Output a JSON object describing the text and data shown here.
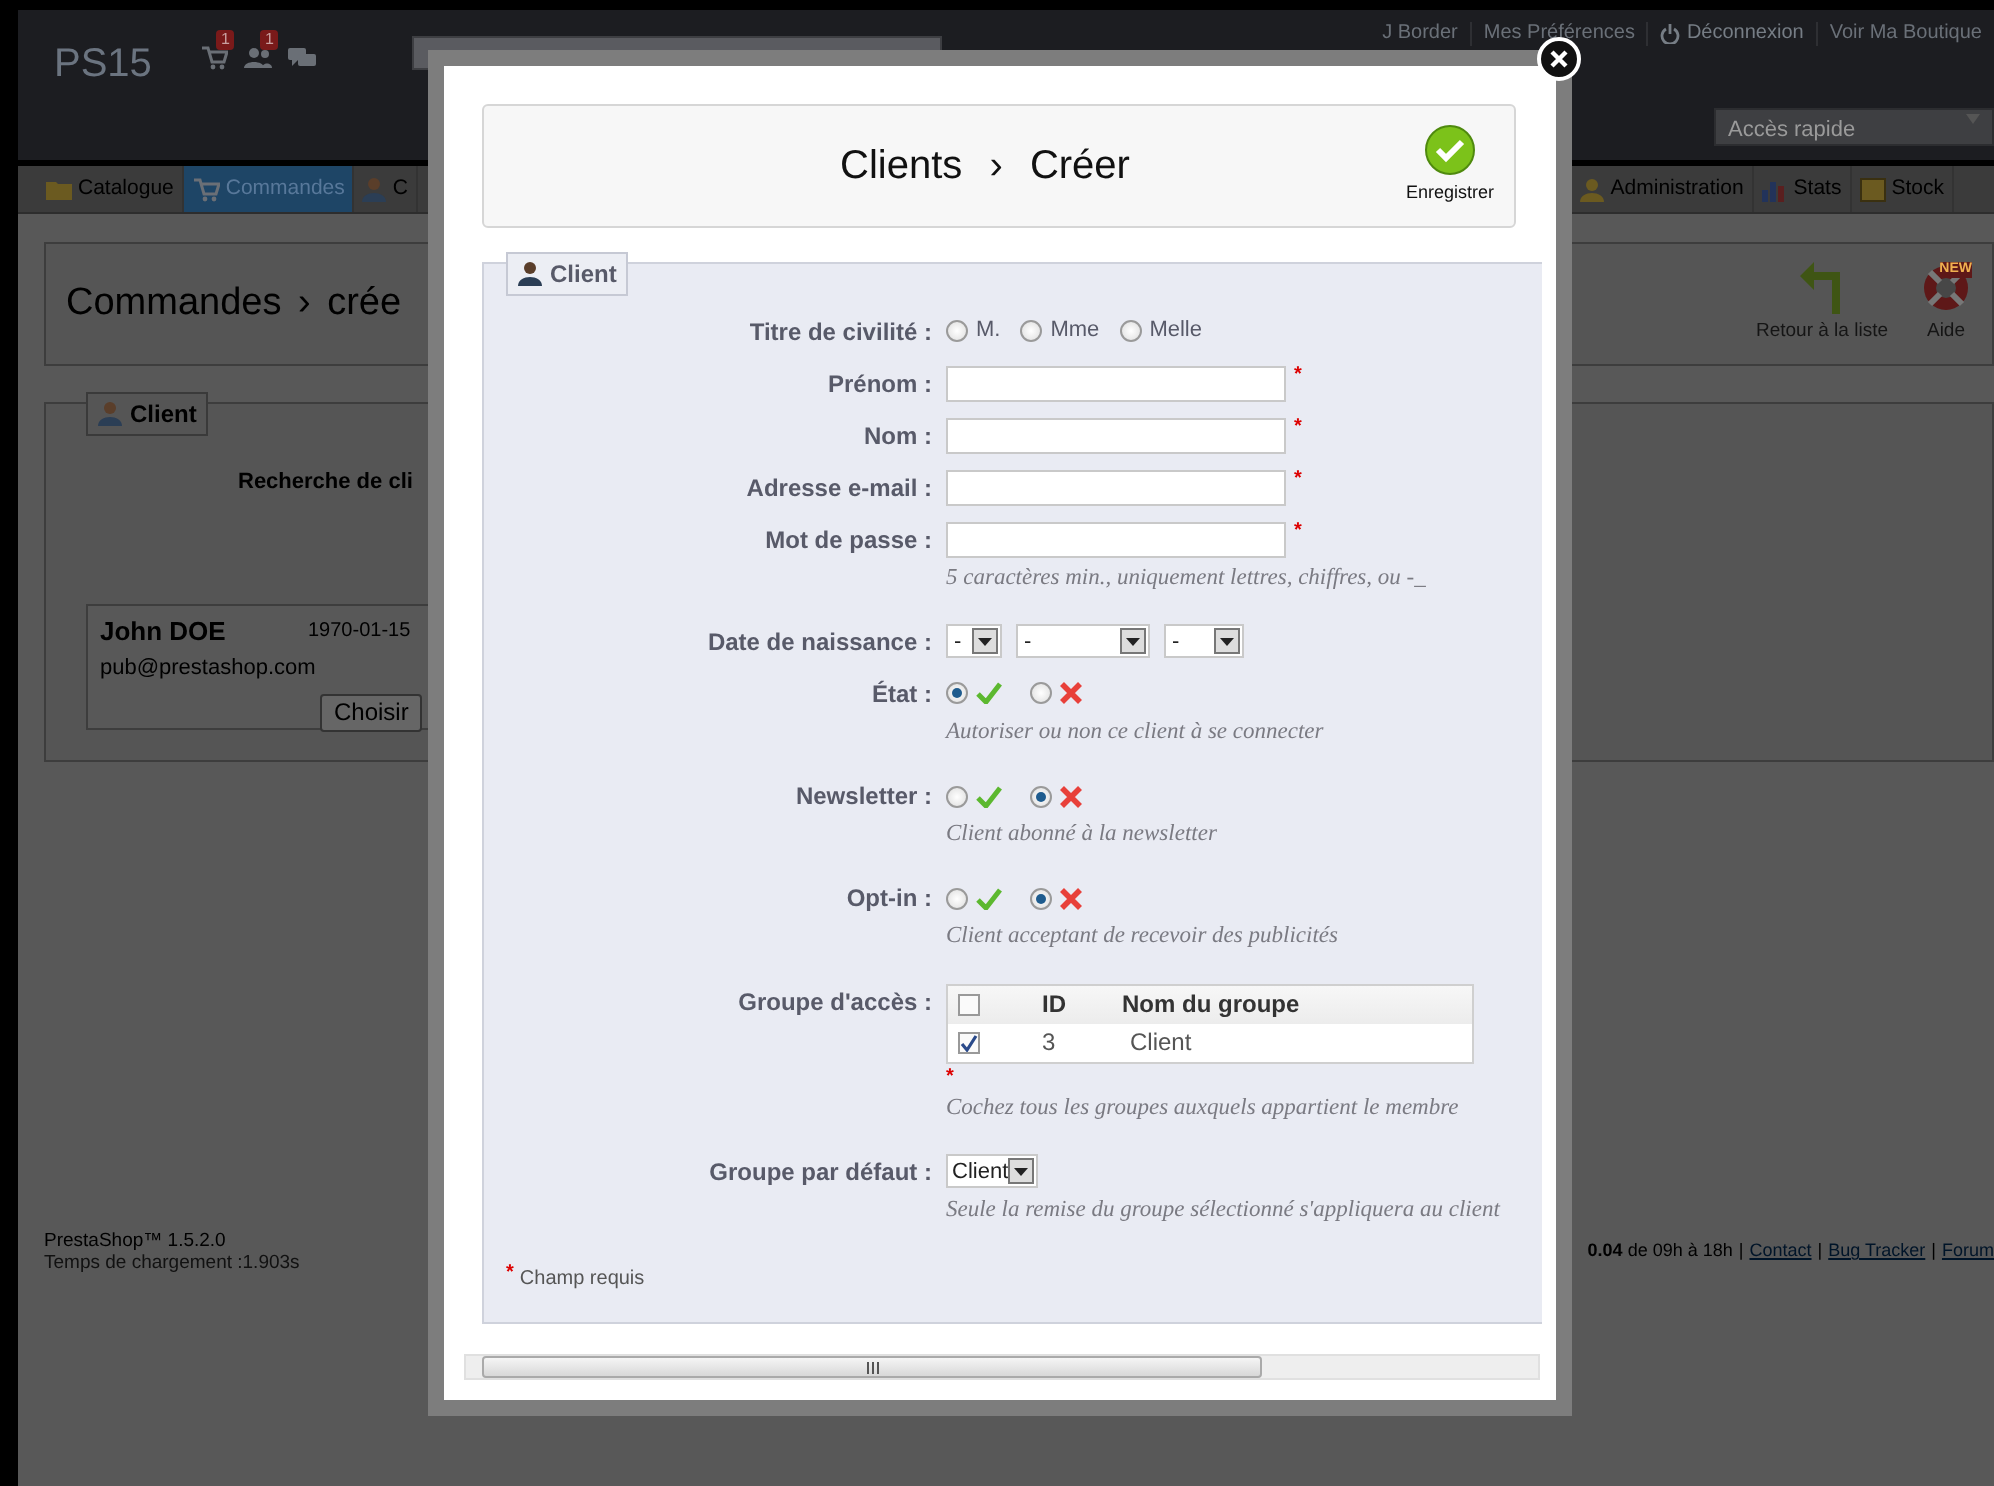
{
  "header": {
    "logo": "PS15",
    "notifications": [
      {
        "kind": "cart",
        "badge": "1"
      },
      {
        "kind": "customers",
        "badge": "1"
      },
      {
        "kind": "messages"
      }
    ],
    "links": [
      {
        "kind": "text",
        "label": "J Border"
      },
      {
        "kind": "text",
        "label": "Mes Préférences"
      },
      {
        "kind": "logout",
        "label": "Déconnexion"
      },
      {
        "kind": "text",
        "label": "Voir Ma Boutique"
      }
    ],
    "quick_access": "Accès rapide"
  },
  "menu": {
    "left": [
      {
        "kind": "folder",
        "label": "Catalogue",
        "selected": false
      },
      {
        "kind": "cart",
        "label": "Commandes",
        "selected": true
      },
      {
        "kind": "user",
        "label": "C",
        "selected": false
      }
    ],
    "right": [
      {
        "kind": "admin",
        "label": "Administration",
        "selected": false
      },
      {
        "kind": "stats",
        "label": "Stats",
        "selected": false
      },
      {
        "kind": "stock",
        "label": "Stock",
        "selected": false
      }
    ]
  },
  "page": {
    "title": "Commandes › crée",
    "toolbar": [
      {
        "kind": "back",
        "label": "Retour à la liste"
      },
      {
        "kind": "help",
        "label": "Aide",
        "badge": "NEW"
      }
    ],
    "client_panel": {
      "legend": "Client",
      "search_label": "Recherche de cli",
      "customer": {
        "name": "John DOE",
        "birthdate": "1970-01-15",
        "email": "pub@prestashop.com",
        "button": "Choisir"
      }
    },
    "footer": {
      "version": "PrestaShop™ 1.5.2.0",
      "load_time": "Temps de chargement :1.903s",
      "items": [
        {
          "kind": "text",
          "text": "**0.04** de 09h à 18h"
        },
        {
          "kind": "sep",
          "text": "|"
        },
        {
          "kind": "link",
          "text": "Contact"
        },
        {
          "kind": "sep",
          "text": "|"
        },
        {
          "kind": "link",
          "text": "Bug Tracker"
        },
        {
          "kind": "sep",
          "text": "|"
        },
        {
          "kind": "link",
          "text": "Forum"
        }
      ]
    }
  },
  "modal": {
    "title": "Clients › Créer",
    "save": "Enregistrer",
    "form": {
      "legend": "Client",
      "rows": [
        {
          "kind": "radio",
          "label": "Titre de civilité :",
          "options": [
            {
              "label": "M.",
              "selected": false
            },
            {
              "label": "Mme",
              "selected": false
            },
            {
              "label": "Melle",
              "selected": false
            }
          ]
        },
        {
          "kind": "text",
          "label": "Prénom :",
          "required_mark": "*"
        },
        {
          "kind": "text",
          "label": "Nom :",
          "required_mark": "*"
        },
        {
          "kind": "text",
          "label": "Adresse e-mail :",
          "required_mark": "*"
        },
        {
          "kind": "text",
          "label": "Mot de passe :",
          "required_mark": "*",
          "hint": "5 caractères min., uniquement lettres, chiffres, ou -_"
        },
        {
          "kind": "date",
          "label": "Date de naissance :",
          "selects": [
            {
              "value": "-"
            },
            {
              "value": "-"
            },
            {
              "value": "-"
            }
          ]
        },
        {
          "kind": "toggle",
          "label": "État :",
          "options": [
            {
              "kind": "yes",
              "selected": true
            },
            {
              "kind": "no",
              "selected": false
            }
          ],
          "hint": "Autoriser ou non ce client à se connecter"
        },
        {
          "kind": "toggle",
          "label": "Newsletter :",
          "options": [
            {
              "kind": "yes",
              "selected": false
            },
            {
              "kind": "no",
              "selected": true
            }
          ],
          "hint": "Client abonné à la newsletter"
        },
        {
          "kind": "toggle",
          "label": "Opt-in :",
          "options": [
            {
              "kind": "yes",
              "selected": false
            },
            {
              "kind": "no",
              "selected": true
            }
          ],
          "hint": "Client acceptant de recevoir des publicités"
        },
        {
          "kind": "groups",
          "label": "Groupe d'accès :",
          "all_checked": false,
          "columns": [
            "ID",
            "Nom du groupe"
          ],
          "groups": [
            {
              "checked": true,
              "id": "3",
              "name": "Client"
            }
          ],
          "required_mark": "*",
          "hint": "Cochez tous les groupes auxquels appartient le membre"
        },
        {
          "kind": "select",
          "label": "Groupe par défaut :",
          "value": "Client",
          "hint": "Seule la remise du groupe sélectionné s'appliquera au client"
        }
      ],
      "required_note": {
        "mark": "*",
        "text": "Champ requis"
      }
    }
  }
}
